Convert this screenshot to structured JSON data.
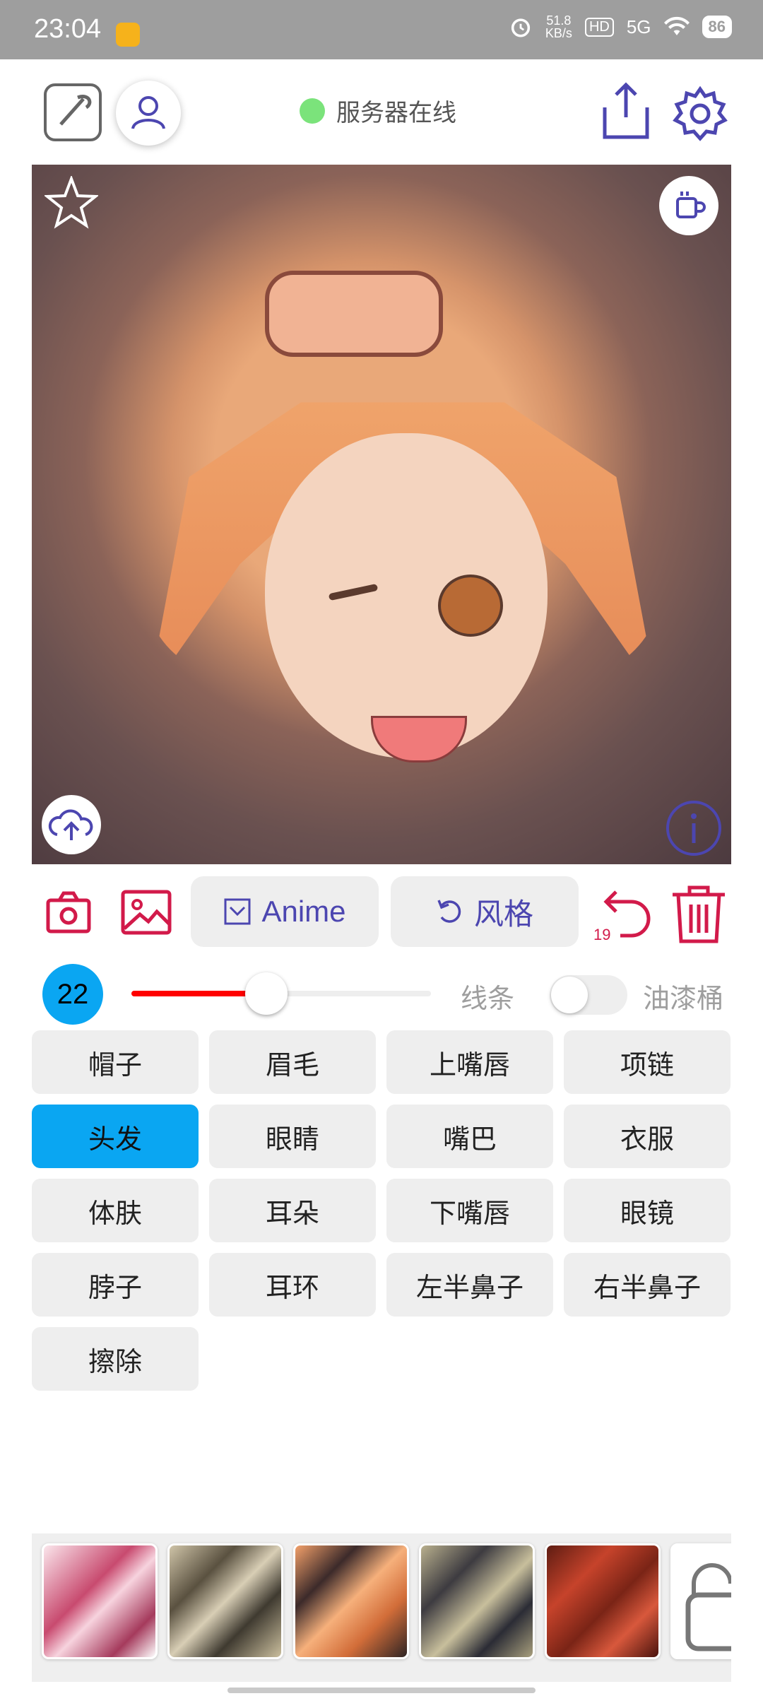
{
  "status_bar": {
    "time": "23:04",
    "net_speed_top": "51.8",
    "net_speed_unit": "KB/s",
    "hd_badge": "HD",
    "network": "5G",
    "battery": "86"
  },
  "header": {
    "server_status": "服务器在线",
    "server_status_color": "#7be37b"
  },
  "toolbar": {
    "anime_label": "Anime",
    "style_label": "风格",
    "undo_count": "19",
    "accent_color": "#d21a4a",
    "primary_color": "#4c46b0"
  },
  "brush": {
    "size": "22",
    "slider_fraction": 0.45,
    "line_label": "线条",
    "bucket_label": "油漆桶",
    "bucket_enabled": false
  },
  "parts": [
    {
      "label": "帽子"
    },
    {
      "label": "眉毛"
    },
    {
      "label": "上嘴唇"
    },
    {
      "label": "项链"
    },
    {
      "label": "头发",
      "selected": true
    },
    {
      "label": "眼睛"
    },
    {
      "label": "嘴巴"
    },
    {
      "label": "衣服"
    },
    {
      "label": "体肤"
    },
    {
      "label": "耳朵"
    },
    {
      "label": "下嘴唇"
    },
    {
      "label": "眼镜"
    },
    {
      "label": "脖子"
    },
    {
      "label": "耳环"
    },
    {
      "label": "左半鼻子"
    },
    {
      "label": "右半鼻子"
    },
    {
      "label": "擦除"
    }
  ],
  "icons": {
    "edit": "edit-icon",
    "user": "user-icon",
    "share": "share-icon",
    "settings": "gear-icon",
    "favorite": "star-icon",
    "cup": "cup-icon",
    "upload": "cloud-upload-icon",
    "info": "info-icon",
    "camera": "camera-icon",
    "gallery": "image-icon",
    "undo": "undo-icon",
    "delete": "trash-icon",
    "locked": "lock-icon"
  }
}
